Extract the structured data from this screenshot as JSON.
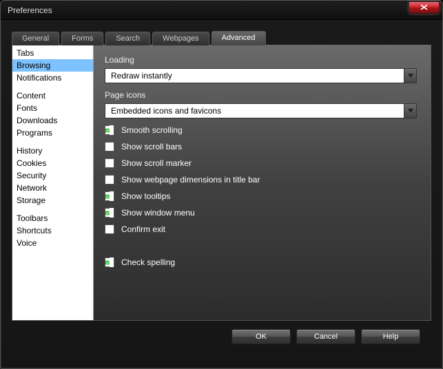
{
  "window": {
    "title": "Preferences"
  },
  "tabs": [
    {
      "label": "General"
    },
    {
      "label": "Forms"
    },
    {
      "label": "Search"
    },
    {
      "label": "Webpages"
    },
    {
      "label": "Advanced",
      "active": true
    }
  ],
  "sidebar": {
    "groups": [
      [
        "Tabs",
        "Browsing",
        "Notifications"
      ],
      [
        "Content",
        "Fonts",
        "Downloads",
        "Programs"
      ],
      [
        "History",
        "Cookies",
        "Security",
        "Network",
        "Storage"
      ],
      [
        "Toolbars",
        "Shortcuts",
        "Voice"
      ]
    ],
    "selected": "Browsing"
  },
  "main": {
    "loading_label": "Loading",
    "loading_value": "Redraw instantly",
    "page_icons_label": "Page icons",
    "page_icons_value": "Embedded icons and favicons",
    "options": [
      {
        "key": "smooth_scrolling",
        "label": "Smooth scrolling",
        "checked": true
      },
      {
        "key": "show_scroll_bars",
        "label": "Show scroll bars",
        "checked": false
      },
      {
        "key": "show_scroll_marker",
        "label": "Show scroll marker",
        "checked": false
      },
      {
        "key": "show_dimensions",
        "label": "Show webpage dimensions in title bar",
        "checked": false
      },
      {
        "key": "show_tooltips",
        "label": "Show tooltips",
        "checked": true
      },
      {
        "key": "show_window_menu",
        "label": "Show window menu",
        "checked": true
      },
      {
        "key": "confirm_exit",
        "label": "Confirm exit",
        "checked": false
      }
    ],
    "spelling": {
      "label": "Check spelling",
      "checked": true
    }
  },
  "footer": {
    "ok": "OK",
    "cancel": "Cancel",
    "help": "Help"
  },
  "colors": {
    "accent_check": "#3fbf3f",
    "selection": "#7dc2ff"
  }
}
